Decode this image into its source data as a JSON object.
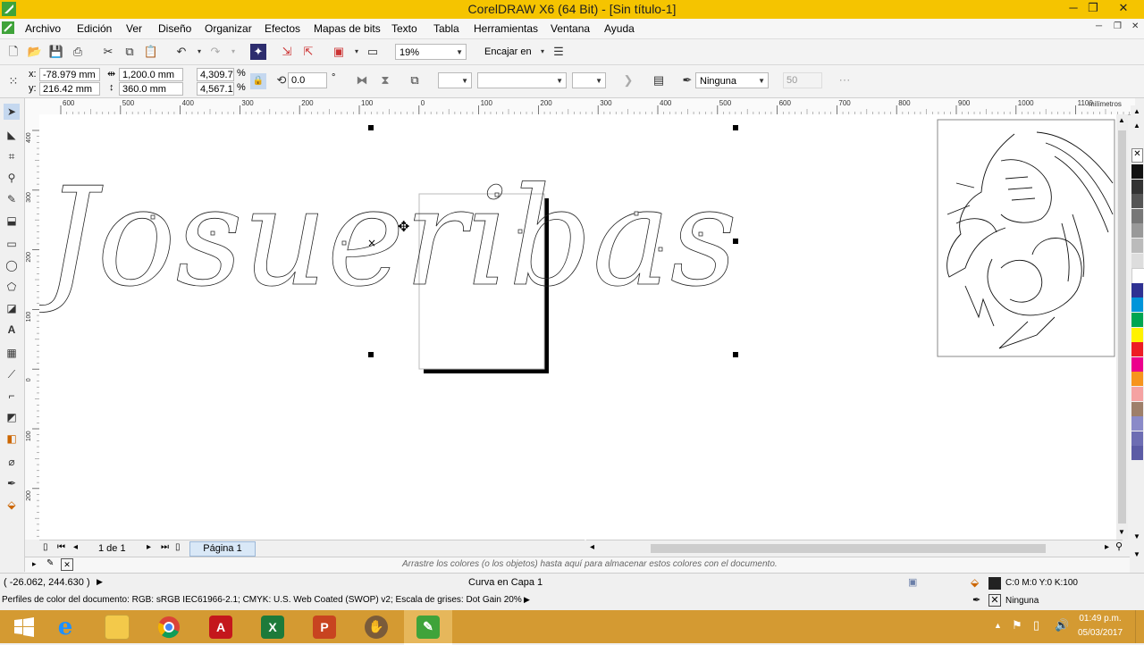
{
  "app": {
    "title": "CorelDRAW X6 (64 Bit) - [Sin título-1]"
  },
  "window_controls": {
    "minimize": "─",
    "restore": "❐",
    "close": "✕"
  },
  "menu": [
    "Archivo",
    "Edición",
    "Ver",
    "Diseño",
    "Organizar",
    "Efectos",
    "Mapas de bits",
    "Texto",
    "Tabla",
    "Herramientas",
    "Ventana",
    "Ayuda"
  ],
  "standard_toolbar": {
    "zoom_value": "19%",
    "snap_label": "Encajar en"
  },
  "property_bar": {
    "x_label": "x:",
    "x_value": "-78.979 mm",
    "y_label": "y:",
    "y_value": "216.42 mm",
    "width_value": "1,200.0 mm",
    "height_value": "360.0 mm",
    "scale_w": "4,309.7",
    "scale_h": "4,567.1",
    "pct": "%",
    "rotation_value": "0.0",
    "degree": "°",
    "outline_value": "Ninguna",
    "opacity_value": "50"
  },
  "ruler": {
    "unit": "milímetros",
    "h_ticks": [
      "600",
      "500",
      "400",
      "300",
      "200",
      "100",
      "0",
      "100",
      "200",
      "300",
      "400",
      "500",
      "600",
      "700",
      "800",
      "900",
      "1000",
      "1100"
    ],
    "v_ticks": [
      "400",
      "300",
      "200",
      "100",
      "0",
      "100",
      "200"
    ]
  },
  "canvas": {
    "script_text": "Josueribas"
  },
  "page_nav": {
    "page_count": "1 de 1",
    "page_tab": "Página 1"
  },
  "doc_palette_hint": "Arrastre los colores (o los objetos) hasta aquí para almacenar estos colores con el documento.",
  "status": {
    "coords": "( -26.062, 244.630 )",
    "object_info": "Curva en Capa 1",
    "fill_info": "C:0 M:0 Y:0 K:100",
    "outline_info": "Ninguna",
    "color_profiles": "Perfiles de color del documento: RGB: sRGB IEC61966-2.1; CMYK: U.S. Web Coated (SWOP) v2; Escala de grises: Dot Gain 20%"
  },
  "palette_colors": [
    "#111111",
    "#333333",
    "#555555",
    "#777777",
    "#999999",
    "#bbbbbb",
    "#dddddd",
    "#ffffff",
    "#2e3192",
    "#0095da",
    "#00a651",
    "#fff200",
    "#ed1c24",
    "#ec008c",
    "#f7941d",
    "#f5a2a2",
    "#9e7f6a",
    "#8a8ac8",
    "#6d6db3",
    "#5b5ba5"
  ],
  "taskbar": {
    "time": "01:49 p.m.",
    "date": "05/03/2017",
    "apps": [
      "windows-start",
      "internet-explorer",
      "file-explorer",
      "chrome",
      "acrobat",
      "excel",
      "powerpoint",
      "gimp",
      "coreldraw"
    ]
  }
}
